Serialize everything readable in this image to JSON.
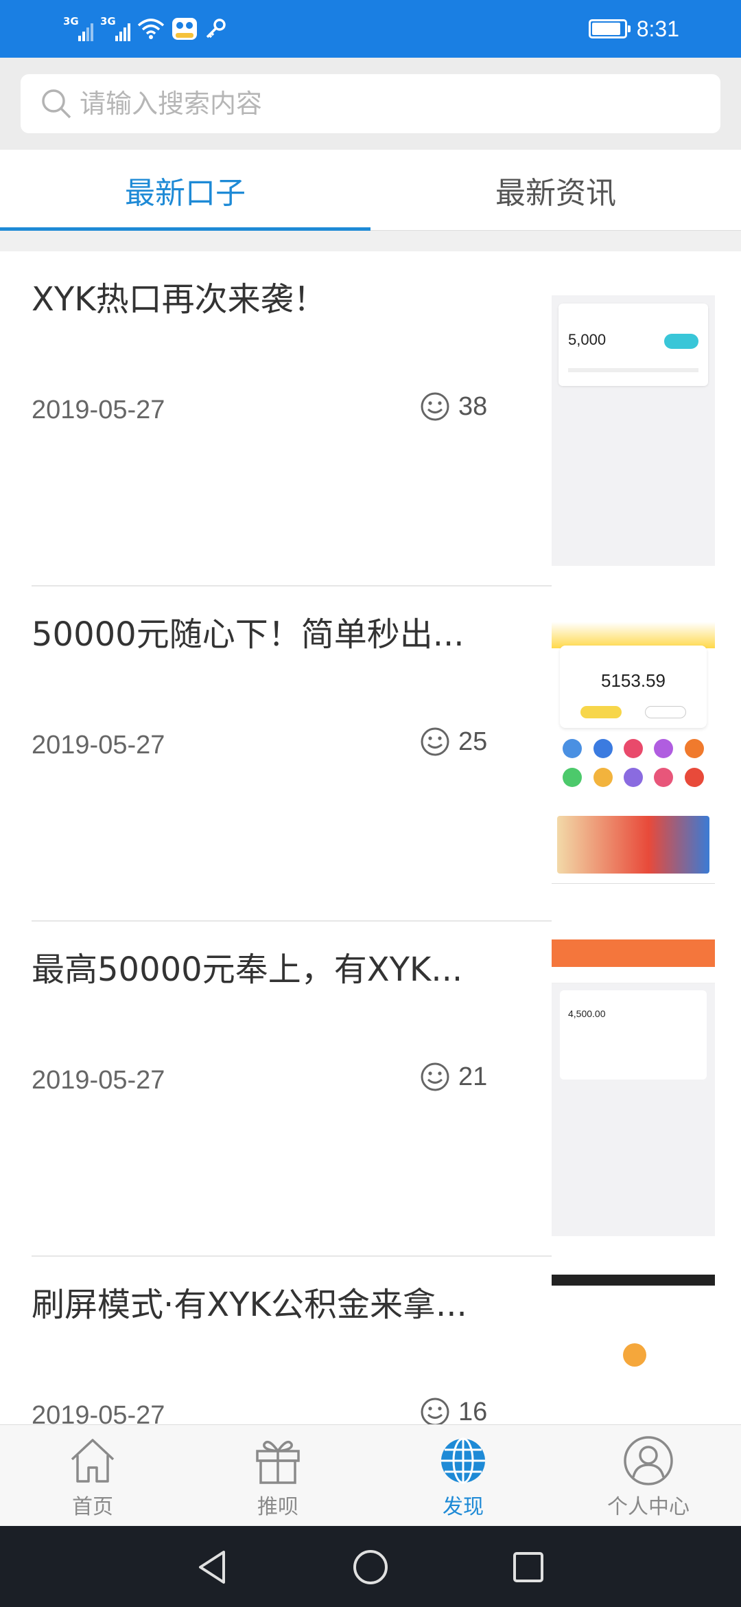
{
  "status_bar": {
    "network_left": "3G",
    "network_right": "3G",
    "time": "8:31",
    "battery_level": 0.9,
    "icons": [
      "signal-icon",
      "signal-icon",
      "wifi-icon",
      "mascot-app-icon",
      "key-icon",
      "battery-icon"
    ]
  },
  "search": {
    "placeholder": "请输入搜索内容"
  },
  "tabs": [
    {
      "label": "最新口子",
      "active": true
    },
    {
      "label": "最新资讯",
      "active": false
    }
  ],
  "articles": [
    {
      "title": "XYK热口再次来袭！",
      "date": "2019-05-27",
      "likes": "38"
    },
    {
      "title": "50000元随心下！简单秒出...",
      "date": "2019-05-27",
      "likes": "25"
    },
    {
      "title": "最高50000元奉上，有XYK...",
      "date": "2019-05-27",
      "likes": "21"
    },
    {
      "title": "刷屏模式·有XYK公积金来拿...",
      "date": "2019-05-27",
      "likes": "16"
    }
  ],
  "bottom_nav": [
    {
      "label": "首页",
      "icon": "home-icon",
      "active": false
    },
    {
      "label": "推呗",
      "icon": "gift-icon",
      "active": false
    },
    {
      "label": "发现",
      "icon": "globe-icon",
      "active": true
    },
    {
      "label": "个人中心",
      "icon": "user-icon",
      "active": false
    }
  ],
  "system_nav": {
    "icons": [
      "back-icon",
      "home-circle-icon",
      "recents-icon"
    ]
  },
  "colors": {
    "status_bar": "#1a7fe3",
    "accent": "#1e8ad6",
    "nav_inactive": "#8a8a8a",
    "system_nav": "#1b1f26"
  }
}
